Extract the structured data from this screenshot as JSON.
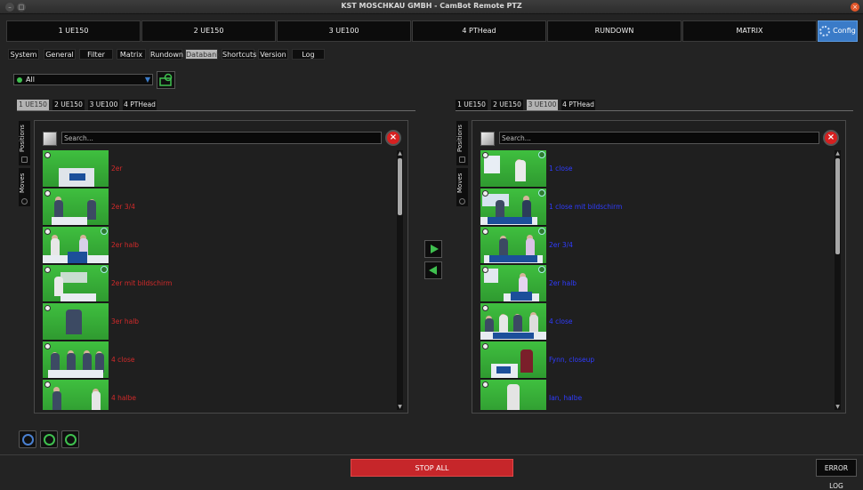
{
  "window": {
    "title": "KST MOSCHKAU GMBH - CamBot Remote PTZ"
  },
  "top_tabs": [
    "1 UE150",
    "2 UE150",
    "3 UE100",
    "4 PTHead",
    "RUNDOWN",
    "MATRIX",
    "Config"
  ],
  "sub_tabs": [
    "System",
    "General",
    "Filter",
    "Matrix",
    "Rundown",
    "Databank",
    "Shortcuts",
    "Version",
    "Log"
  ],
  "sub_tab_active": "Databank",
  "filter": {
    "value": "All"
  },
  "camera_tabs": [
    "1 UE150",
    "2 UE150",
    "3 UE100",
    "4 PTHead"
  ],
  "left": {
    "active_camera": "1 UE150",
    "side_tabs": [
      "Positions",
      "Moves"
    ],
    "search_placeholder": "Search...",
    "items": [
      "2er",
      "2er 3/4",
      "2er halb",
      "2er mit bildschirm",
      "3er halb",
      "4 close",
      "4 halbe"
    ]
  },
  "right": {
    "active_camera": "3 UE100",
    "side_tabs": [
      "Positions",
      "Moves"
    ],
    "search_placeholder": "Search...",
    "items": [
      "1 close",
      "1 close mit bildschirm",
      "2er 3/4",
      "2er halb",
      "4 close",
      "Fynn, closeup",
      "Ian, halbe"
    ]
  },
  "buttons": {
    "stop_all": "STOP ALL",
    "error_log": "ERROR LOG"
  },
  "colors": {
    "accent": "#3a7bc8",
    "stop": "#c6262a",
    "left_item_text": "#d22a2a",
    "right_item_text": "#2f3cff",
    "thumbnail_green": "#3fbf3f"
  }
}
